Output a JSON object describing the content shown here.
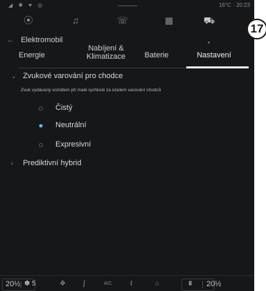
{
  "status_bar": {
    "signals": "◢ ✱ ♥ ◎",
    "weather": "16°C",
    "sep": "·",
    "time": "20:23"
  },
  "top_nav": [
    {
      "icon": "location-pin-icon",
      "glyph": "⦿",
      "active": false
    },
    {
      "icon": "music-note-icon",
      "glyph": "♫",
      "active": false
    },
    {
      "icon": "phone-icon",
      "glyph": "☏",
      "active": false
    },
    {
      "icon": "apps-grid-icon",
      "glyph": "▦",
      "active": false
    },
    {
      "icon": "car-icon",
      "glyph": "⛟",
      "active": true
    }
  ],
  "breadcrumb": {
    "back_glyph": "←",
    "title": "Elektromobil"
  },
  "tabs": [
    {
      "label": "Energie",
      "active": false
    },
    {
      "label": "Nabíjení &\nKlimatizace",
      "active": false
    },
    {
      "label": "Baterie",
      "active": false
    },
    {
      "label": "Nastavení",
      "active": true
    }
  ],
  "callout": {
    "label": "17"
  },
  "settings": {
    "section1_title": "Zvukové varování pro chodce",
    "section1_chevron": "⌄",
    "section1_desc": "Zvuk vydávaný vozidlem při malé rychlosti za účelem varování chodců",
    "options": [
      {
        "label": "Čistý",
        "selected": false
      },
      {
        "label": "Neutrální",
        "selected": true
      },
      {
        "label": "Expresivní",
        "selected": false
      }
    ],
    "section2_title": "Prediktivní hybrid",
    "section2_chevron": "›"
  },
  "bottom_bar": {
    "temp_left": "20",
    "fan_glyph": "✽",
    "fan_speed": "5",
    "icons": [
      {
        "icon": "defrost-icon",
        "glyph": "❖"
      },
      {
        "icon": "seat-heat-icon",
        "glyph": "∫"
      },
      {
        "icon": "ac-icon",
        "glyph": "A/C"
      },
      {
        "icon": "steering-heat-icon",
        "glyph": "ℓ"
      },
      {
        "icon": "rear-defrost-icon",
        "glyph": "⌂"
      }
    ],
    "airflow_glyph": "⩩",
    "temp_right": "20",
    "temp_unit_glyph": "½"
  },
  "colors": {
    "accent": "#6fb8e0",
    "background": "#161719"
  }
}
